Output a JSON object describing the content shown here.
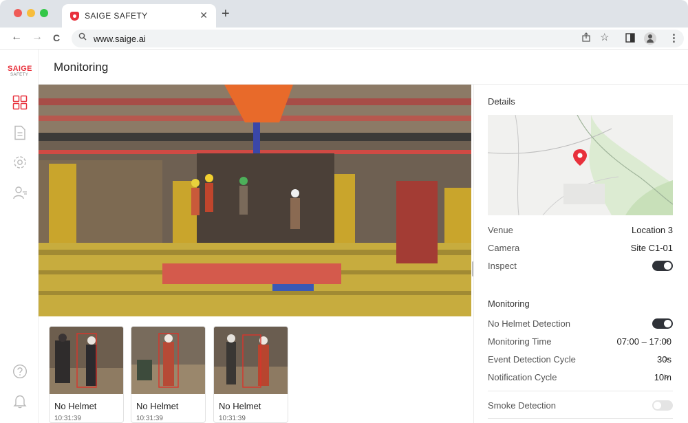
{
  "browser": {
    "tab_title": "SAIGE SAFETY",
    "tab_close": "✕",
    "new_tab": "+",
    "url": "www.saige.ai",
    "back": "←",
    "forward": "→",
    "reload": "C"
  },
  "app": {
    "logo_main": "SAIGE",
    "logo_sub": "SAFETY",
    "page_title": "Monitoring",
    "sidebar_icons": [
      "dashboard-icon",
      "document-icon",
      "settings-icon",
      "users-icon",
      "help-icon",
      "bell-icon"
    ]
  },
  "events": [
    {
      "label": "No Helmet",
      "time": "10:31:39"
    },
    {
      "label": "No Helmet",
      "time": "10:31:39"
    },
    {
      "label": "No Helmet",
      "time": "10:31:39"
    }
  ],
  "details": {
    "title": "Details",
    "venue_label": "Venue",
    "venue_value": "Location 3",
    "camera_label": "Camera",
    "camera_value": "Site C1-01",
    "inspect_label": "Inspect",
    "inspect_on": true
  },
  "monitoring": {
    "title": "Monitoring",
    "no_helmet_label": "No Helmet Detection",
    "no_helmet_on": true,
    "time_label": "Monitoring Time",
    "time_value": "07:00 – 17:00",
    "event_cycle_label": "Event Detection Cycle",
    "event_cycle_value": "30s",
    "notify_cycle_label": "Notification Cycle",
    "notify_cycle_value": "10m",
    "smoke_label": "Smoke Detection",
    "smoke_on": false
  },
  "colors": {
    "brand": "#e8313c",
    "toggle_on": "#2f3238",
    "toggle_off": "#e4e4e4",
    "detection_box": "#d9352b"
  }
}
